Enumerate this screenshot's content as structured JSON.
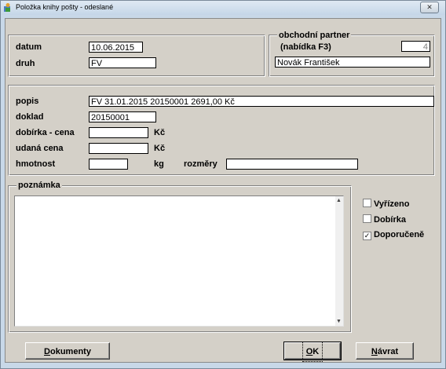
{
  "window": {
    "title": "Položka knihy pošty - odeslané",
    "close_label": "✕"
  },
  "header": {
    "datum_label": "datum",
    "datum_value": "10.06.2015",
    "druh_label": "druh",
    "druh_value": "FV"
  },
  "partner": {
    "legend": "obchodní partner",
    "hint": "(nabídka F3)",
    "id_value": "4",
    "name_value": "Novák František"
  },
  "details": {
    "popis_label": "popis",
    "popis_value": "FV  31.01.2015  20150001  2691,00 Kč",
    "doklad_label": "doklad",
    "doklad_value": "20150001",
    "dobirka_label": "dobírka - cena",
    "dobirka_value": "",
    "dobirka_unit": "Kč",
    "udana_label": "udaná cena",
    "udana_value": "",
    "udana_unit": "Kč",
    "hmotnost_label": "hmotnost",
    "hmotnost_value": "",
    "hmotnost_unit": "kg",
    "rozmery_label": "rozměry",
    "rozmery_value": ""
  },
  "note": {
    "legend": "poznámka",
    "value": ""
  },
  "options": {
    "vyrizeno_label": "Vyřízeno",
    "vyrizeno_checked": false,
    "dobirka_label": "Dobírka",
    "dobirka_checked": false,
    "doporuceno_label": "Doporučeně",
    "doporuceno_checked": true
  },
  "buttons": {
    "dokumenty_first": "D",
    "dokumenty_rest": "okumenty",
    "ok_first": "O",
    "ok_rest": "K",
    "navrat_first": "N",
    "navrat_rest": "ávrat"
  }
}
